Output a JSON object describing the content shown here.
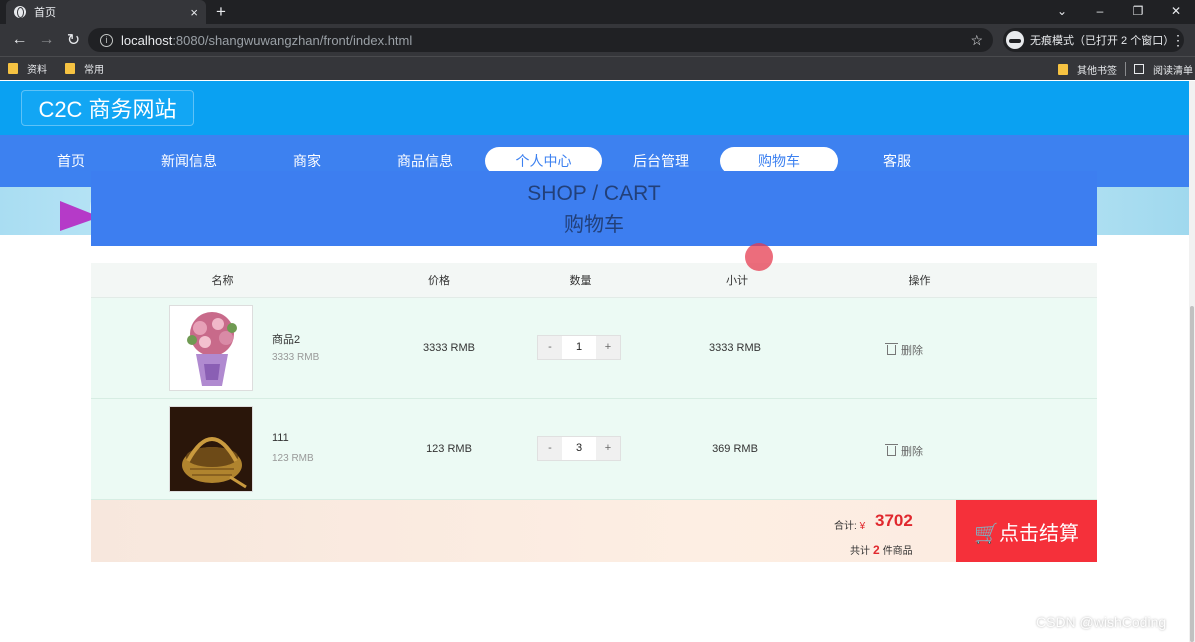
{
  "browser": {
    "tab_title": "首页",
    "tab_close": "×",
    "new_tab": "+",
    "window_controls": [
      "⌄",
      "–",
      "❐",
      "✕"
    ],
    "url_host": "localhost",
    "url_rest": ":8080/shangwuwangzhan/front/index.html",
    "incognito_label": "无痕模式（已打开 2 个窗口）",
    "bookmarks": [
      "资料",
      "常用"
    ],
    "bookmarks_right": [
      "其他书签",
      "阅读清单"
    ]
  },
  "site": {
    "logo": "C2C 商务网站",
    "nav": [
      "首页",
      "新闻信息",
      "商家",
      "商品信息",
      "个人中心",
      "后台管理",
      "购物车",
      "客服"
    ]
  },
  "cart": {
    "header_en": "SHOP / CART",
    "header_cn": "购物车",
    "columns": [
      "名称",
      "价格",
      "数量",
      "小计",
      "操作"
    ],
    "items": [
      {
        "name": "商品2",
        "unit_price": "3333 RMB",
        "price": "3333 RMB",
        "qty": "1",
        "subtotal": "3333 RMB",
        "delete": "删除"
      },
      {
        "name": "111",
        "unit_price": "123 RMB",
        "price": "123 RMB",
        "qty": "3",
        "subtotal": "369 RMB",
        "delete": "删除"
      }
    ],
    "minus": "-",
    "plus": "+",
    "total_label": "合计:",
    "currency": "¥",
    "total": "3702",
    "count_prefix": "共计",
    "count": "2",
    "count_suffix": "件商品",
    "checkout": "🛒点击结算"
  },
  "watermark": "CSDN @wishCoding"
}
